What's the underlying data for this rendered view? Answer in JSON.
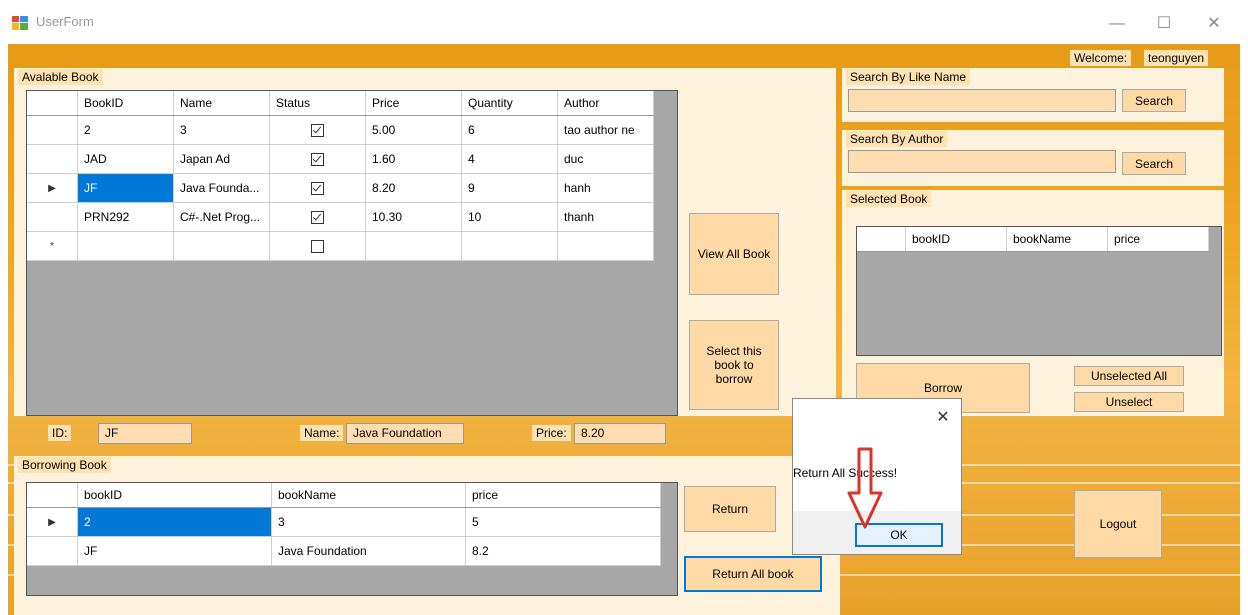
{
  "window": {
    "title": "UserForm",
    "minimize": "—",
    "maximize": "☐",
    "close": "✕"
  },
  "welcome": {
    "label": "Welcome:",
    "user": "teonguyen"
  },
  "available": {
    "caption": "Avalable Book",
    "columns": [
      "BookID",
      "Name",
      "Status",
      "Price",
      "Quantity",
      "Author"
    ],
    "rows": [
      {
        "marker": "",
        "id": "2",
        "name": "3",
        "status": true,
        "price": "5.00",
        "qty": "6",
        "author": "tao author ne"
      },
      {
        "marker": "",
        "id": "JAD",
        "name": "Japan Ad",
        "status": true,
        "price": "1.60",
        "qty": "4",
        "author": "duc"
      },
      {
        "marker": "▶",
        "id": "JF",
        "name": "Java Founda...",
        "status": true,
        "price": "8.20",
        "qty": "9",
        "author": "hanh"
      },
      {
        "marker": "",
        "id": "PRN292",
        "name": "C#-.Net Prog...",
        "status": true,
        "price": "10.30",
        "qty": "10",
        "author": "thanh"
      },
      {
        "marker": "*",
        "id": "",
        "name": "",
        "status": false,
        "price": "",
        "qty": "",
        "author": ""
      }
    ]
  },
  "buttons": {
    "view_all": "View All Book",
    "select_borrow": "Select this book to borrow",
    "borrow": "Borrow",
    "unselected_all": "Unselected All",
    "unselect": "Unselect",
    "return": "Return",
    "return_all": "Return All book",
    "logout": "Logout",
    "search": "Search"
  },
  "search_name": {
    "caption": "Search By Like Name",
    "value": ""
  },
  "search_author": {
    "caption": "Search By Author",
    "value": ""
  },
  "selected": {
    "caption": "Selected Book",
    "columns": [
      "bookID",
      "bookName",
      "price"
    ]
  },
  "detail": {
    "id_label": "ID:",
    "id_value": "JF",
    "name_label": "Name:",
    "name_value": "Java Foundation",
    "price_label": "Price:",
    "price_value": "8.20"
  },
  "borrowing": {
    "caption": "Borrowing Book",
    "columns": [
      "bookID",
      "bookName",
      "price"
    ],
    "rows": [
      {
        "marker": "▶",
        "id": "2",
        "name": "3",
        "price": "5"
      },
      {
        "marker": "",
        "id": "JF",
        "name": "Java Foundation",
        "price": "8.2"
      }
    ]
  },
  "dialog": {
    "message": "Return All Success!",
    "ok": "OK",
    "close": "✕"
  },
  "colors": {
    "accent": "#0078d7",
    "button": "#ffd9a6",
    "panel": "#fdf2dc",
    "arrow": "#d9342b"
  }
}
